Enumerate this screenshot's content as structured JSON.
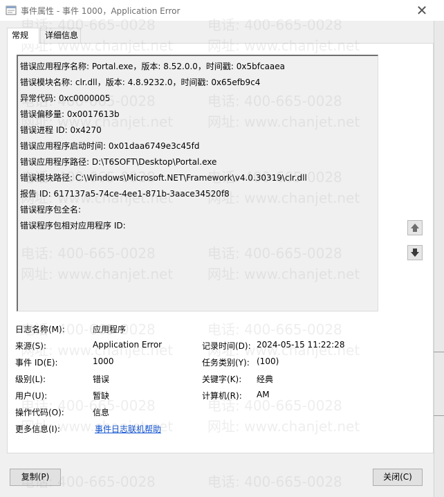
{
  "window": {
    "title": "事件属性 - 事件 1000，Application Error",
    "close_glyph": "✕"
  },
  "tabs": [
    {
      "label": "常规",
      "active": true
    },
    {
      "label": "详细信息",
      "active": false
    }
  ],
  "description": {
    "lines": [
      "错误应用程序名称: Portal.exe，版本: 8.52.0.0，时间戳: 0x5bfcaaea",
      "错误模块名称: clr.dll，版本: 4.8.9232.0，时间戳: 0x65efb9c4",
      "异常代码: 0xc0000005",
      "错误偏移量: 0x0017613b",
      "错误进程 ID: 0x4270",
      "错误应用程序启动时间: 0x01daa6749e3c45fd",
      "错误应用程序路径: D:\\T6SOFT\\Desktop\\Portal.exe",
      "错误模块路径: C:\\Windows\\Microsoft.NET\\Framework\\v4.0.30319\\clr.dll",
      "报告 ID: 617137a5-74ce-4ee1-871b-3aace34520f8",
      "错误程序包全名:",
      "错误程序包相对应用程序 ID:"
    ]
  },
  "scroll": {
    "up_icon": "arrow-up-icon",
    "down_icon": "arrow-down-icon"
  },
  "properties": {
    "log_name_label": "日志名称(M):",
    "log_name": "应用程序",
    "source_label": "来源(S):",
    "source": "Application Error",
    "logged_label": "记录时间(D):",
    "logged": "2024-05-15 11:22:28",
    "event_id_label": "事件 ID(E):",
    "event_id": "1000",
    "task_label": "任务类别(Y):",
    "task": "(100)",
    "level_label": "级别(L):",
    "level": "错误",
    "keywords_label": "关键字(K):",
    "keywords": "经典",
    "user_label": "用户(U):",
    "user": "暂缺",
    "computer_label": "计算机(R):",
    "computer": "AM",
    "opcode_label": "操作代码(O):",
    "opcode": "信息",
    "more_info_label": "更多信息(I):",
    "more_info_link": "事件日志联机帮助"
  },
  "buttons": {
    "copy": "复制(P)",
    "close": "关闭(C)"
  },
  "watermark": {
    "phone": "电话: 400-665-0028",
    "site": "网址: www.chanjet.net"
  }
}
